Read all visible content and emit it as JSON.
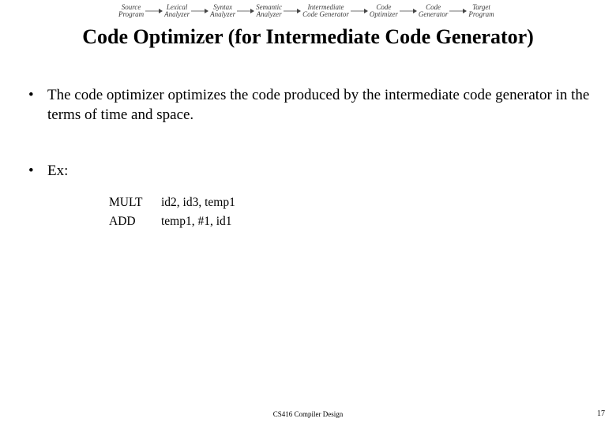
{
  "pipeline": {
    "nodes": [
      "Source\nProgram",
      "Lexical\nAnalyzer",
      "Syntax\nAnalyzer",
      "Semantic\nAnalyzer",
      "Intermediate\nCode Generator",
      "Code\nOptimizer",
      "Code\nGenerator",
      "Target\nProgram"
    ]
  },
  "title": "Code Optimizer (for Intermediate Code Generator)",
  "bullets": {
    "b1": "The code optimizer optimizes the code produced by the intermediate code generator in the terms of time and space.",
    "b2": "Ex:"
  },
  "code": {
    "rows": [
      {
        "op": "MULT",
        "args": "id2, id3, temp1"
      },
      {
        "op": "ADD",
        "args": "temp1, #1, id1"
      }
    ]
  },
  "footer": {
    "center": "CS416 Compiler Design",
    "page": "17"
  }
}
